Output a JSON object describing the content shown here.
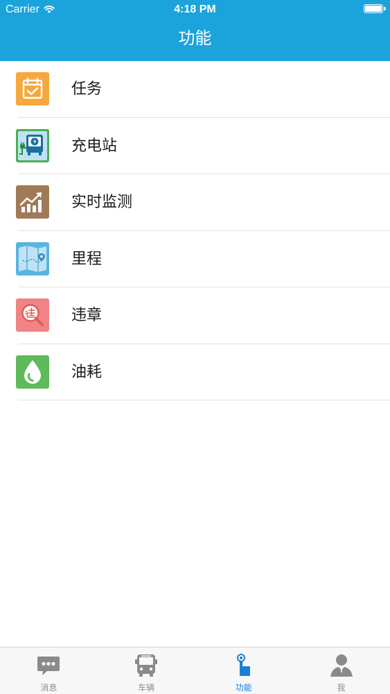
{
  "status_bar": {
    "carrier": "Carrier",
    "time": "4:18 PM"
  },
  "header": {
    "title": "功能",
    "background_color": "#1ba3dc"
  },
  "menu": {
    "items": [
      {
        "label": "任务",
        "icon": "task-calendar-icon",
        "icon_color": "#f6a83e"
      },
      {
        "label": "充电站",
        "icon": "charging-station-icon",
        "icon_color": "#4caf50"
      },
      {
        "label": "实时监测",
        "icon": "realtime-chart-icon",
        "icon_color": "#a07a57"
      },
      {
        "label": "里程",
        "icon": "mileage-map-icon",
        "icon_color": "#5ab4e0"
      },
      {
        "label": "违章",
        "icon": "violation-search-icon",
        "icon_color": "#f08484"
      },
      {
        "label": "油耗",
        "icon": "fuel-drop-icon",
        "icon_color": "#5fba5c"
      }
    ]
  },
  "tab_bar": {
    "active_index": 2,
    "active_color": "#1a7fd4",
    "tabs": [
      {
        "label": "消息",
        "icon": "message-icon"
      },
      {
        "label": "车辆",
        "icon": "bus-icon"
      },
      {
        "label": "功能",
        "icon": "function-icon"
      },
      {
        "label": "我",
        "icon": "user-icon"
      }
    ]
  }
}
